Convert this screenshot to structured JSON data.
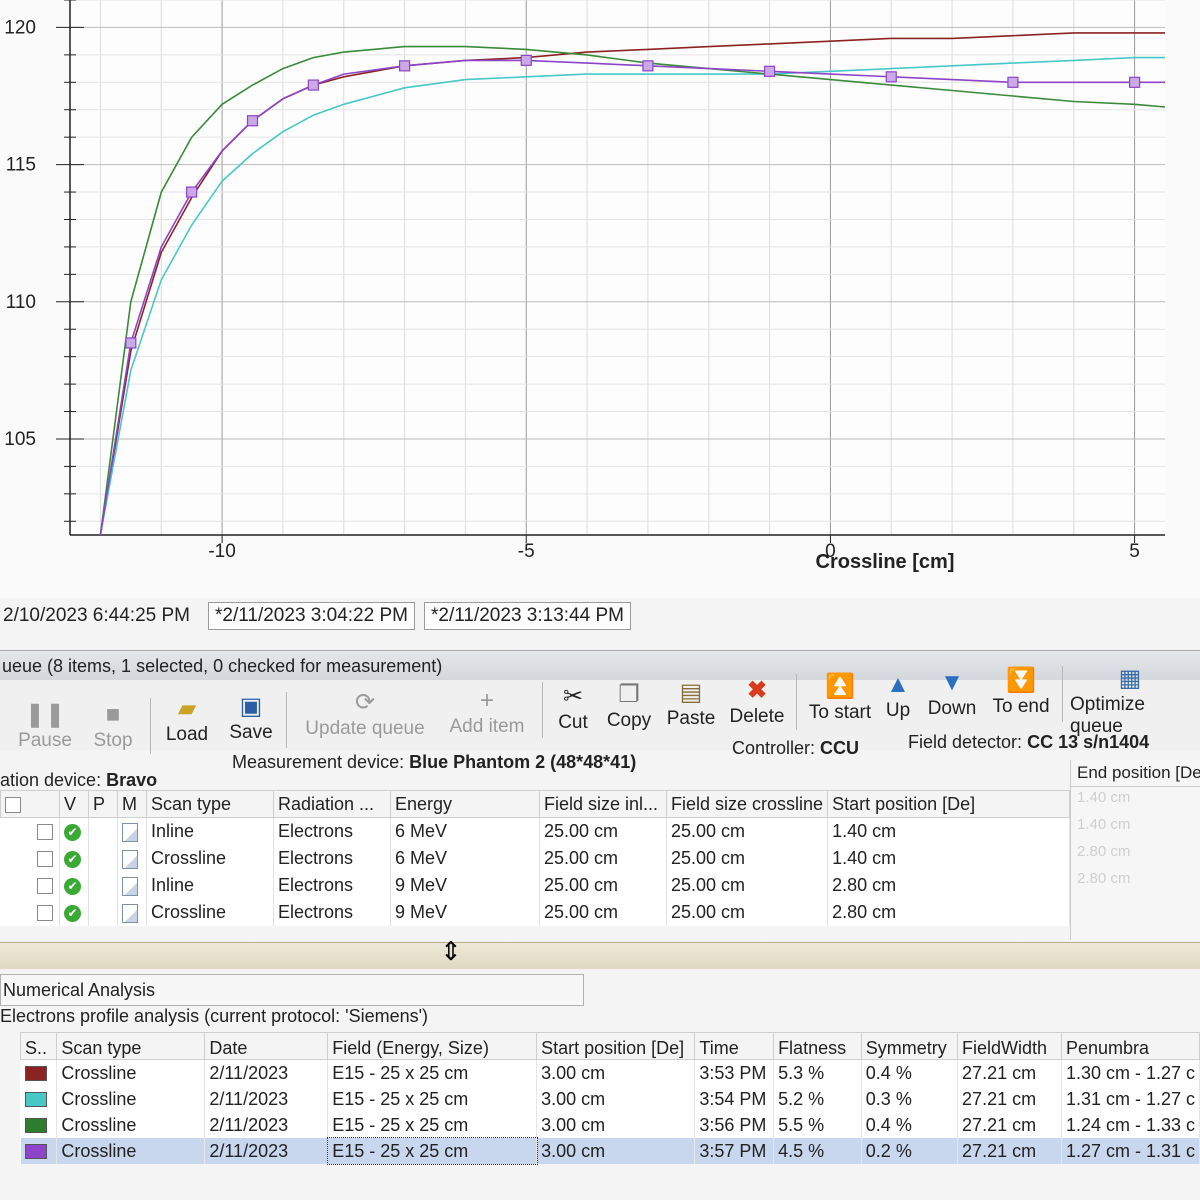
{
  "chart_data": {
    "type": "line",
    "title": "",
    "xlabel": "Crossline [cm]",
    "ylabel": "",
    "xlim": [
      -12.5,
      5.5
    ],
    "ylim": [
      101.5,
      121
    ],
    "x_ticks": [
      "-10",
      "-5",
      "0",
      "5"
    ],
    "y_ticks": [
      "105",
      "110",
      "115",
      "120"
    ],
    "grid": true,
    "series": [
      {
        "color": "#8b2323",
        "x": [
          -12,
          -11.5,
          -11,
          -10.5,
          -10,
          -9.5,
          -9,
          -8.5,
          -8,
          -7,
          -6,
          -5,
          -4,
          -3,
          -2,
          -1,
          0,
          1,
          2,
          3,
          4,
          5,
          5.5
        ],
        "y": [
          101.5,
          108.2,
          111.8,
          113.8,
          115.5,
          116.6,
          117.4,
          117.9,
          118.2,
          118.6,
          118.8,
          118.9,
          119.1,
          119.2,
          119.3,
          119.4,
          119.5,
          119.6,
          119.6,
          119.7,
          119.8,
          119.8,
          119.8
        ]
      },
      {
        "color": "#48c7c7",
        "x": [
          -12,
          -11.5,
          -11,
          -10.5,
          -10,
          -9.5,
          -9,
          -8.5,
          -8,
          -7,
          -6,
          -5,
          -4,
          -3,
          -2,
          -1,
          0,
          1,
          2,
          3,
          4,
          5,
          5.5
        ],
        "y": [
          101.5,
          107.5,
          110.8,
          112.8,
          114.4,
          115.4,
          116.2,
          116.8,
          117.2,
          117.8,
          118.1,
          118.2,
          118.3,
          118.3,
          118.3,
          118.3,
          118.4,
          118.5,
          118.6,
          118.7,
          118.8,
          118.9,
          118.9
        ]
      },
      {
        "color": "#3a8a3a",
        "x": [
          -12,
          -11.5,
          -11,
          -10.5,
          -10,
          -9.5,
          -9,
          -8.5,
          -8,
          -7,
          -6,
          -5,
          -4,
          -3,
          -2,
          -1,
          0,
          1,
          2,
          3,
          4,
          5,
          5.5
        ],
        "y": [
          101.5,
          110.0,
          114.0,
          116.0,
          117.2,
          117.9,
          118.5,
          118.9,
          119.1,
          119.3,
          119.3,
          119.2,
          119.0,
          118.7,
          118.5,
          118.3,
          118.1,
          117.9,
          117.7,
          117.5,
          117.3,
          117.2,
          117.1
        ]
      },
      {
        "color": "#8e44c8",
        "x": [
          -12,
          -11.5,
          -11,
          -10.5,
          -10,
          -9.5,
          -9,
          -8.5,
          -8,
          -7,
          -6,
          -5,
          -4,
          -3,
          -2,
          -1,
          0,
          1,
          2,
          3,
          4,
          5,
          5.5
        ],
        "y": [
          101.5,
          108.5,
          112.0,
          114.0,
          115.5,
          116.6,
          117.4,
          117.9,
          118.3,
          118.6,
          118.8,
          118.8,
          118.7,
          118.6,
          118.5,
          118.4,
          118.3,
          118.2,
          118.1,
          118.0,
          118.0,
          118.0,
          118.0
        ],
        "markers": true
      }
    ]
  },
  "tabs": [
    "2/10/2023 6:44:25 PM",
    "*2/11/2023 3:04:22 PM",
    "*2/11/2023 3:13:44 PM"
  ],
  "queue": {
    "title": "ueue (8 items, 1 selected, 0 checked for measurement)",
    "toolbar": {
      "pause": "Pause",
      "stop": "Stop",
      "load": "Load",
      "save": "Save",
      "update_queue": "Update queue",
      "add_item": "Add item",
      "cut": "Cut",
      "copy": "Copy",
      "paste": "Paste",
      "delete": "Delete",
      "to_start": "To start",
      "up": "Up",
      "down": "Down",
      "to_end": "To end",
      "optimize_queue": "Optimize queue"
    },
    "info": {
      "controller_label": "Controller:",
      "controller_value": "CCU",
      "field_detector_label": "Field detector:",
      "field_detector_value": "CC 13 s/n1404",
      "radiation_device_label": "ation device:",
      "radiation_device_value": "Bravo",
      "measurement_device_label": "Measurement device:",
      "measurement_device_value": "Blue Phantom 2  (48*48*41)"
    },
    "columns": [
      "V",
      "P",
      "M",
      "Scan type",
      "Radiation ...",
      "Energy",
      "Field size inl...",
      "Field size crossline",
      "Start position [De]"
    ],
    "end_position_header": "End position [De]",
    "rows": [
      {
        "scan_type": "Inline",
        "radiation": "Electrons",
        "energy": "6 MeV",
        "fs_inline": "25.00 cm",
        "fs_crossline": "25.00 cm",
        "start": "1.40 cm",
        "end": "1.40 cm"
      },
      {
        "scan_type": "Crossline",
        "radiation": "Electrons",
        "energy": "6 MeV",
        "fs_inline": "25.00 cm",
        "fs_crossline": "25.00 cm",
        "start": "1.40 cm",
        "end": "1.40 cm"
      },
      {
        "scan_type": "Inline",
        "radiation": "Electrons",
        "energy": "9 MeV",
        "fs_inline": "25.00 cm",
        "fs_crossline": "25.00 cm",
        "start": "2.80 cm",
        "end": "2.80 cm"
      },
      {
        "scan_type": "Crossline",
        "radiation": "Electrons",
        "energy": "9 MeV",
        "fs_inline": "25.00 cm",
        "fs_crossline": "25.00 cm",
        "start": "2.80 cm",
        "end": "2.80 cm"
      }
    ]
  },
  "analysis": {
    "title": "Numerical Analysis",
    "subtitle": "Electrons profile analysis (current protocol: 'Siemens')",
    "columns": [
      "S..",
      "Scan type",
      "Date",
      "Field (Energy, Size)",
      "Start position [De]",
      "Time",
      "Flatness",
      "Symmetry",
      "FieldWidth",
      "Penumbra"
    ],
    "rows": [
      {
        "color": "#8b2323",
        "scan_type": "Crossline",
        "date": "2/11/2023",
        "field": "E15 - 25 x 25 cm",
        "start": "3.00 cm",
        "time": "3:53 PM",
        "flatness": "5.3 %",
        "symmetry": "0.4 %",
        "field_width": "27.21 cm",
        "penumbra": "1.30 cm - 1.27 c"
      },
      {
        "color": "#48c7c7",
        "scan_type": "Crossline",
        "date": "2/11/2023",
        "field": "E15 - 25 x 25 cm",
        "start": "3.00 cm",
        "time": "3:54 PM",
        "flatness": "5.2 %",
        "symmetry": "0.3 %",
        "field_width": "27.21 cm",
        "penumbra": "1.31 cm - 1.27 c"
      },
      {
        "color": "#2e7d2e",
        "scan_type": "Crossline",
        "date": "2/11/2023",
        "field": "E15 - 25 x 25 cm",
        "start": "3.00 cm",
        "time": "3:56 PM",
        "flatness": "5.5 %",
        "symmetry": "0.4 %",
        "field_width": "27.21 cm",
        "penumbra": "1.24 cm - 1.33 c"
      },
      {
        "color": "#8e44c8",
        "scan_type": "Crossline",
        "date": "2/11/2023",
        "field": "E15 - 25 x 25 cm",
        "start": "3.00 cm",
        "time": "3:57 PM",
        "flatness": "4.5 %",
        "symmetry": "0.2 %",
        "field_width": "27.21 cm",
        "penumbra": "1.27 cm - 1.31 c"
      }
    ]
  }
}
